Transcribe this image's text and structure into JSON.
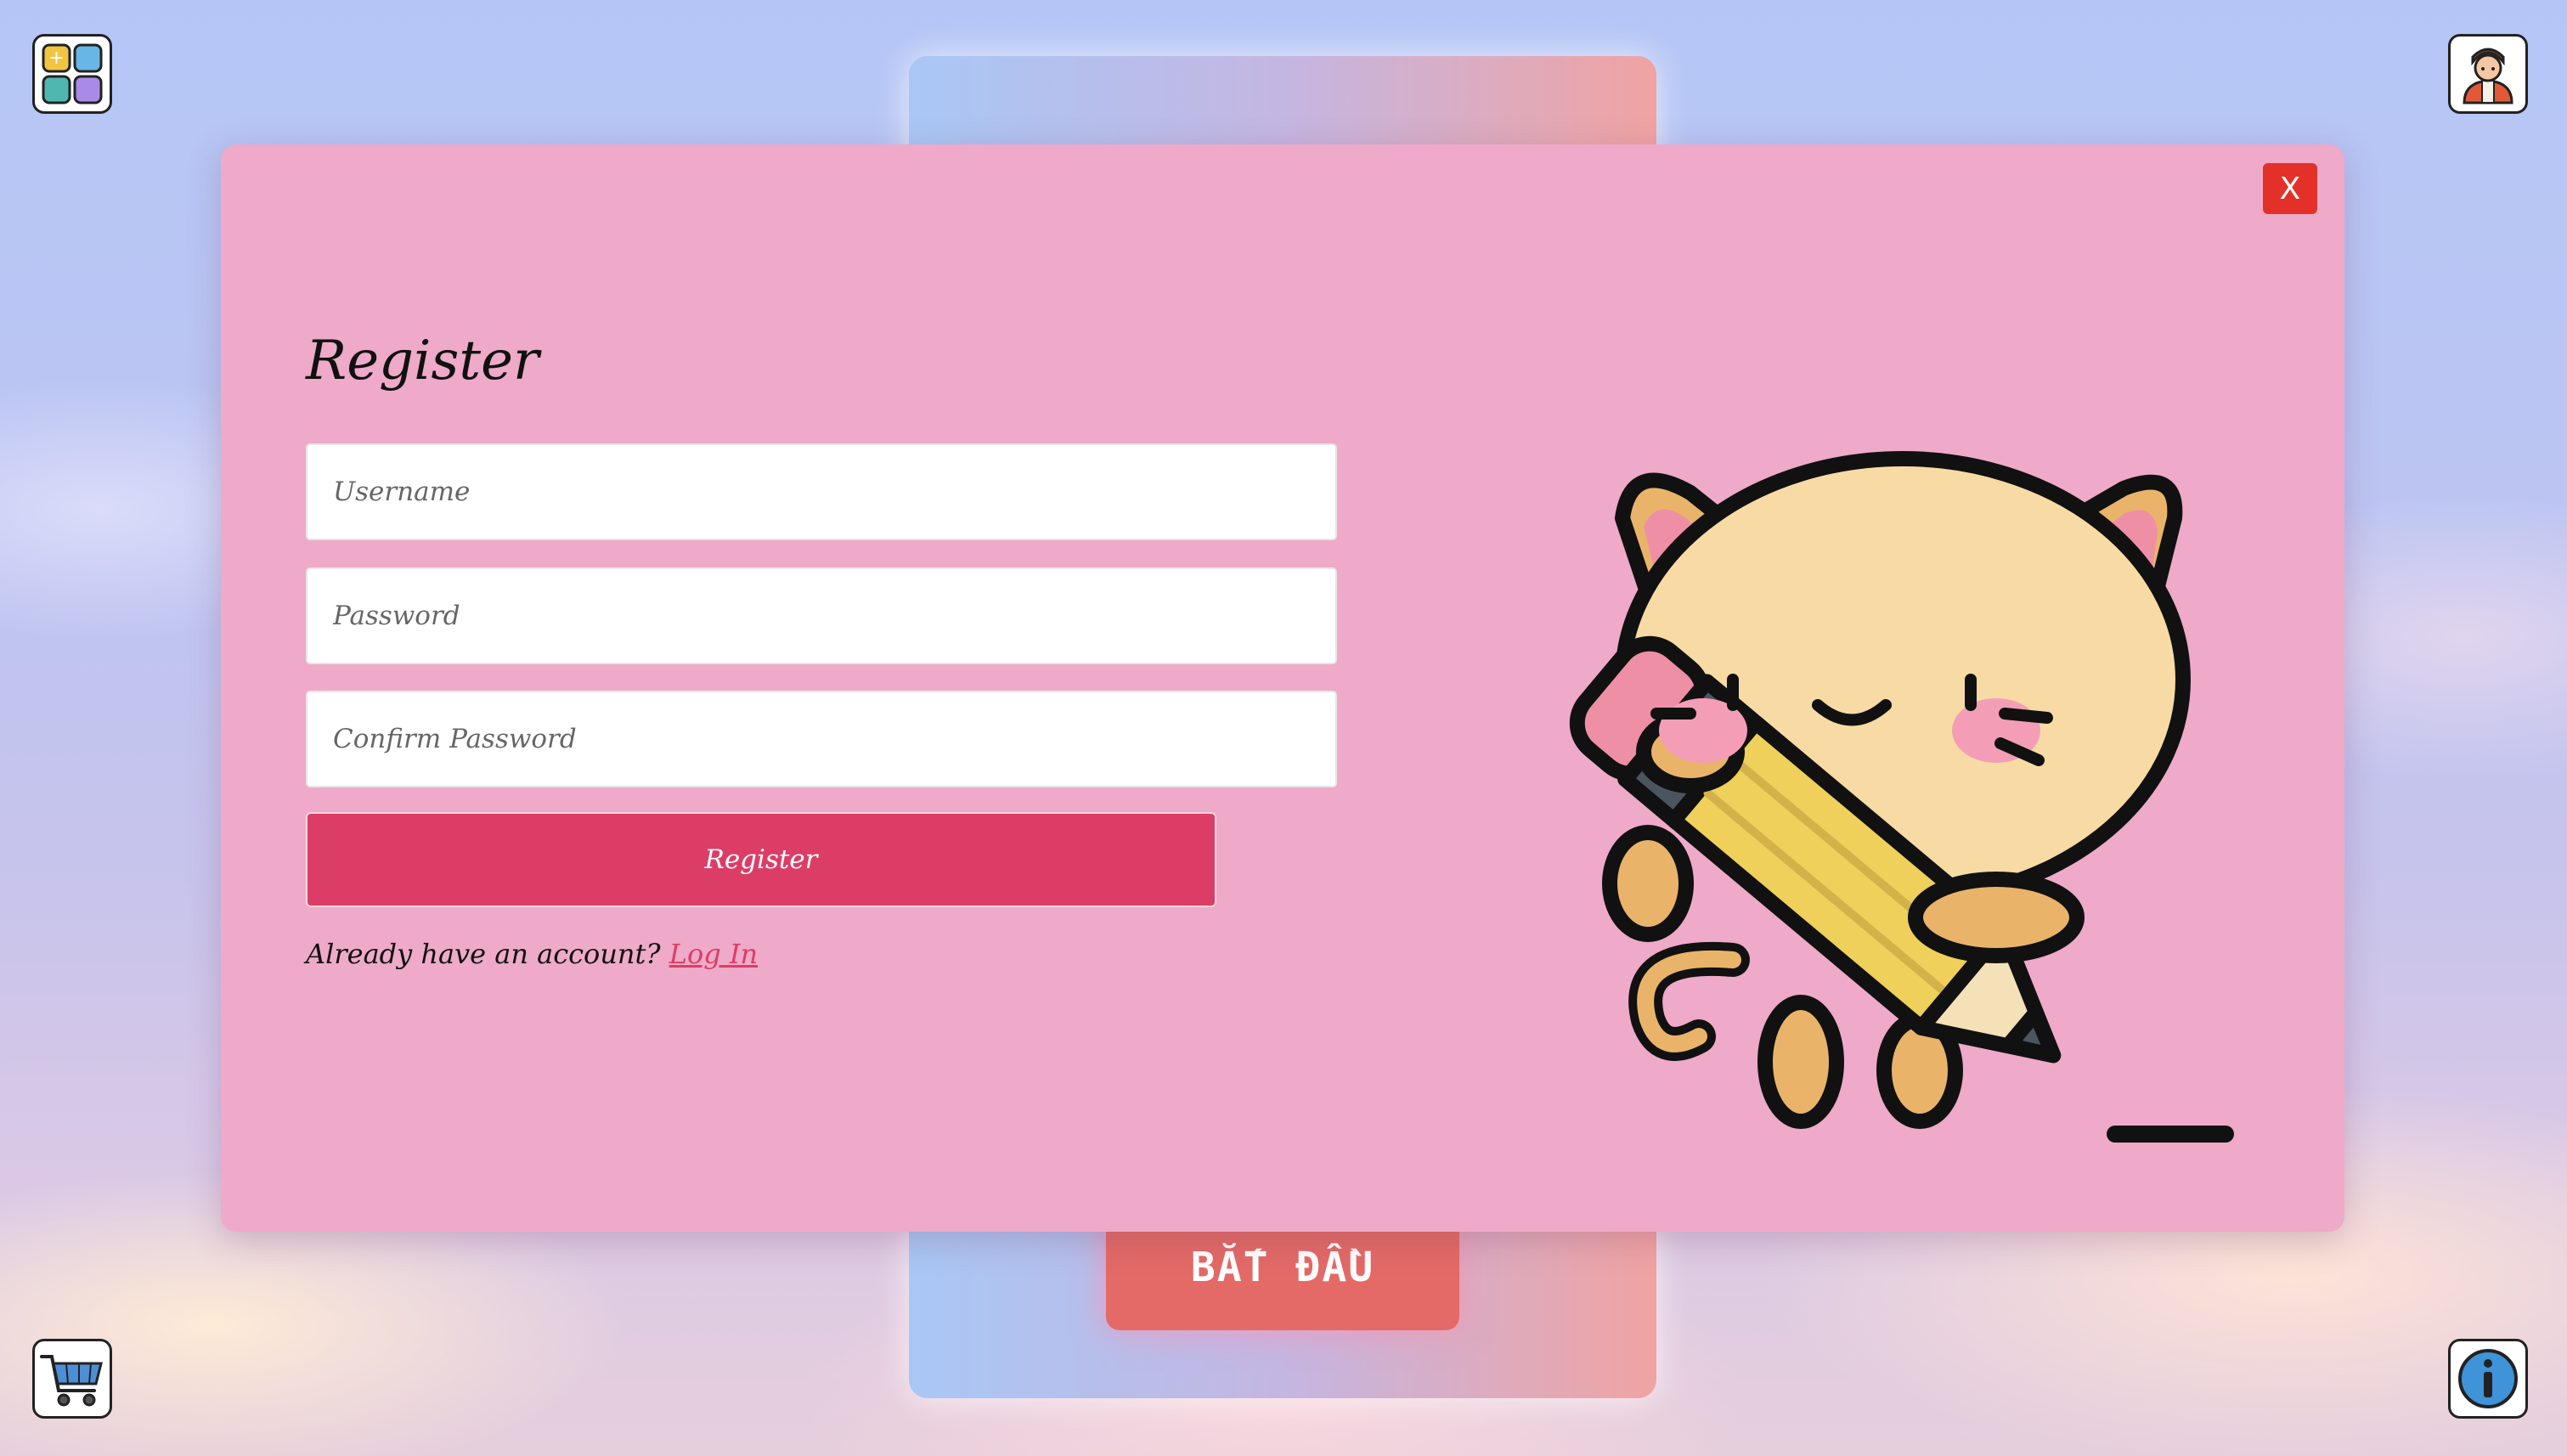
{
  "background": {
    "start_button_label": "BẮT ĐẦU"
  },
  "corner_buttons": {
    "top_left": "apps-grid-icon",
    "top_right": "user-avatar-icon",
    "bottom_left": "shopping-cart-icon",
    "bottom_right": "info-icon"
  },
  "modal": {
    "close_label": "X",
    "title": "Register",
    "fields": {
      "username_placeholder": "Username",
      "password_placeholder": "Password",
      "confirm_placeholder": "Confirm Password"
    },
    "submit_label": "Register",
    "login_prompt": "Already have an account?",
    "login_link": "Log In",
    "illustration": "cat-holding-pencil-illustration"
  },
  "colors": {
    "modal_bg": "#eeaac8",
    "submit_bg": "#dc3d66",
    "close_bg": "#e3312a",
    "start_button_bg": "#e36a66"
  }
}
